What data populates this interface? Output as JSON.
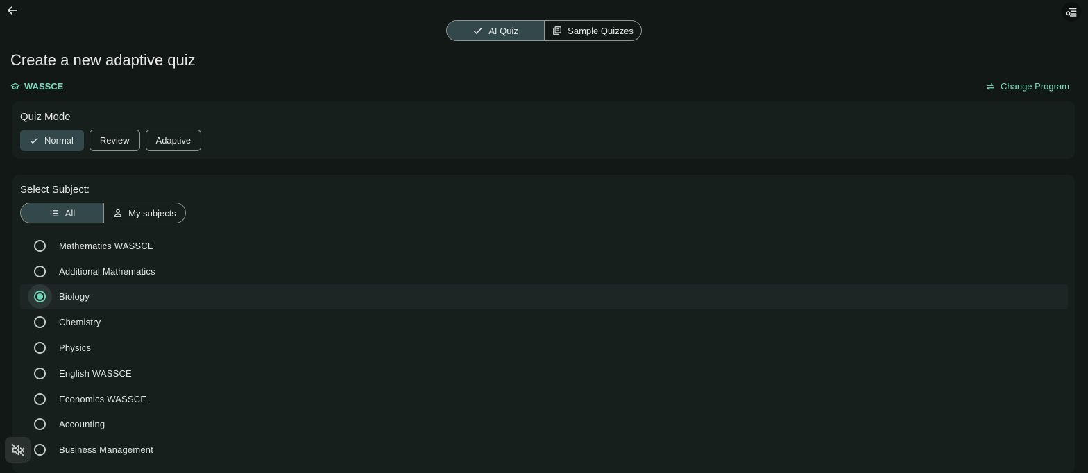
{
  "colors": {
    "background": "#121816",
    "card": "#171f1d",
    "accent": "#7fd8bd",
    "active_segment": "#33484b",
    "radio_checked": "#6fd4b6"
  },
  "header": {
    "back_icon": "arrow-left-icon",
    "menu_icon": "settings-list-icon",
    "tabs": [
      {
        "label": "AI Quiz",
        "icon": "check-icon",
        "active": true
      },
      {
        "label": "Sample Quizzes",
        "icon": "library-icon",
        "active": false
      }
    ]
  },
  "page": {
    "title": "Create a new adaptive quiz",
    "program": "WASSCE",
    "program_icon": "graduation-cap-icon",
    "change_program": "Change Program",
    "change_program_icon": "swap-icon"
  },
  "quiz_mode": {
    "label": "Quiz Mode",
    "options": [
      {
        "label": "Normal",
        "selected": true
      },
      {
        "label": "Review",
        "selected": false
      },
      {
        "label": "Adaptive",
        "selected": false
      }
    ]
  },
  "subjects": {
    "label": "Select Subject:",
    "filters": [
      {
        "label": "All",
        "icon": "list-icon",
        "active": true
      },
      {
        "label": "My subjects",
        "icon": "person-icon",
        "active": false
      }
    ],
    "items": [
      {
        "name": "Mathematics WASSCE",
        "selected": false
      },
      {
        "name": "Additional Mathematics",
        "selected": false
      },
      {
        "name": "Biology",
        "selected": true
      },
      {
        "name": "Chemistry",
        "selected": false
      },
      {
        "name": "Physics",
        "selected": false
      },
      {
        "name": "English WASSCE",
        "selected": false
      },
      {
        "name": "Economics WASSCE",
        "selected": false
      },
      {
        "name": "Accounting",
        "selected": false
      },
      {
        "name": "Business Management",
        "selected": false
      }
    ]
  },
  "footer": {
    "mute_icon": "volume-off-icon"
  }
}
